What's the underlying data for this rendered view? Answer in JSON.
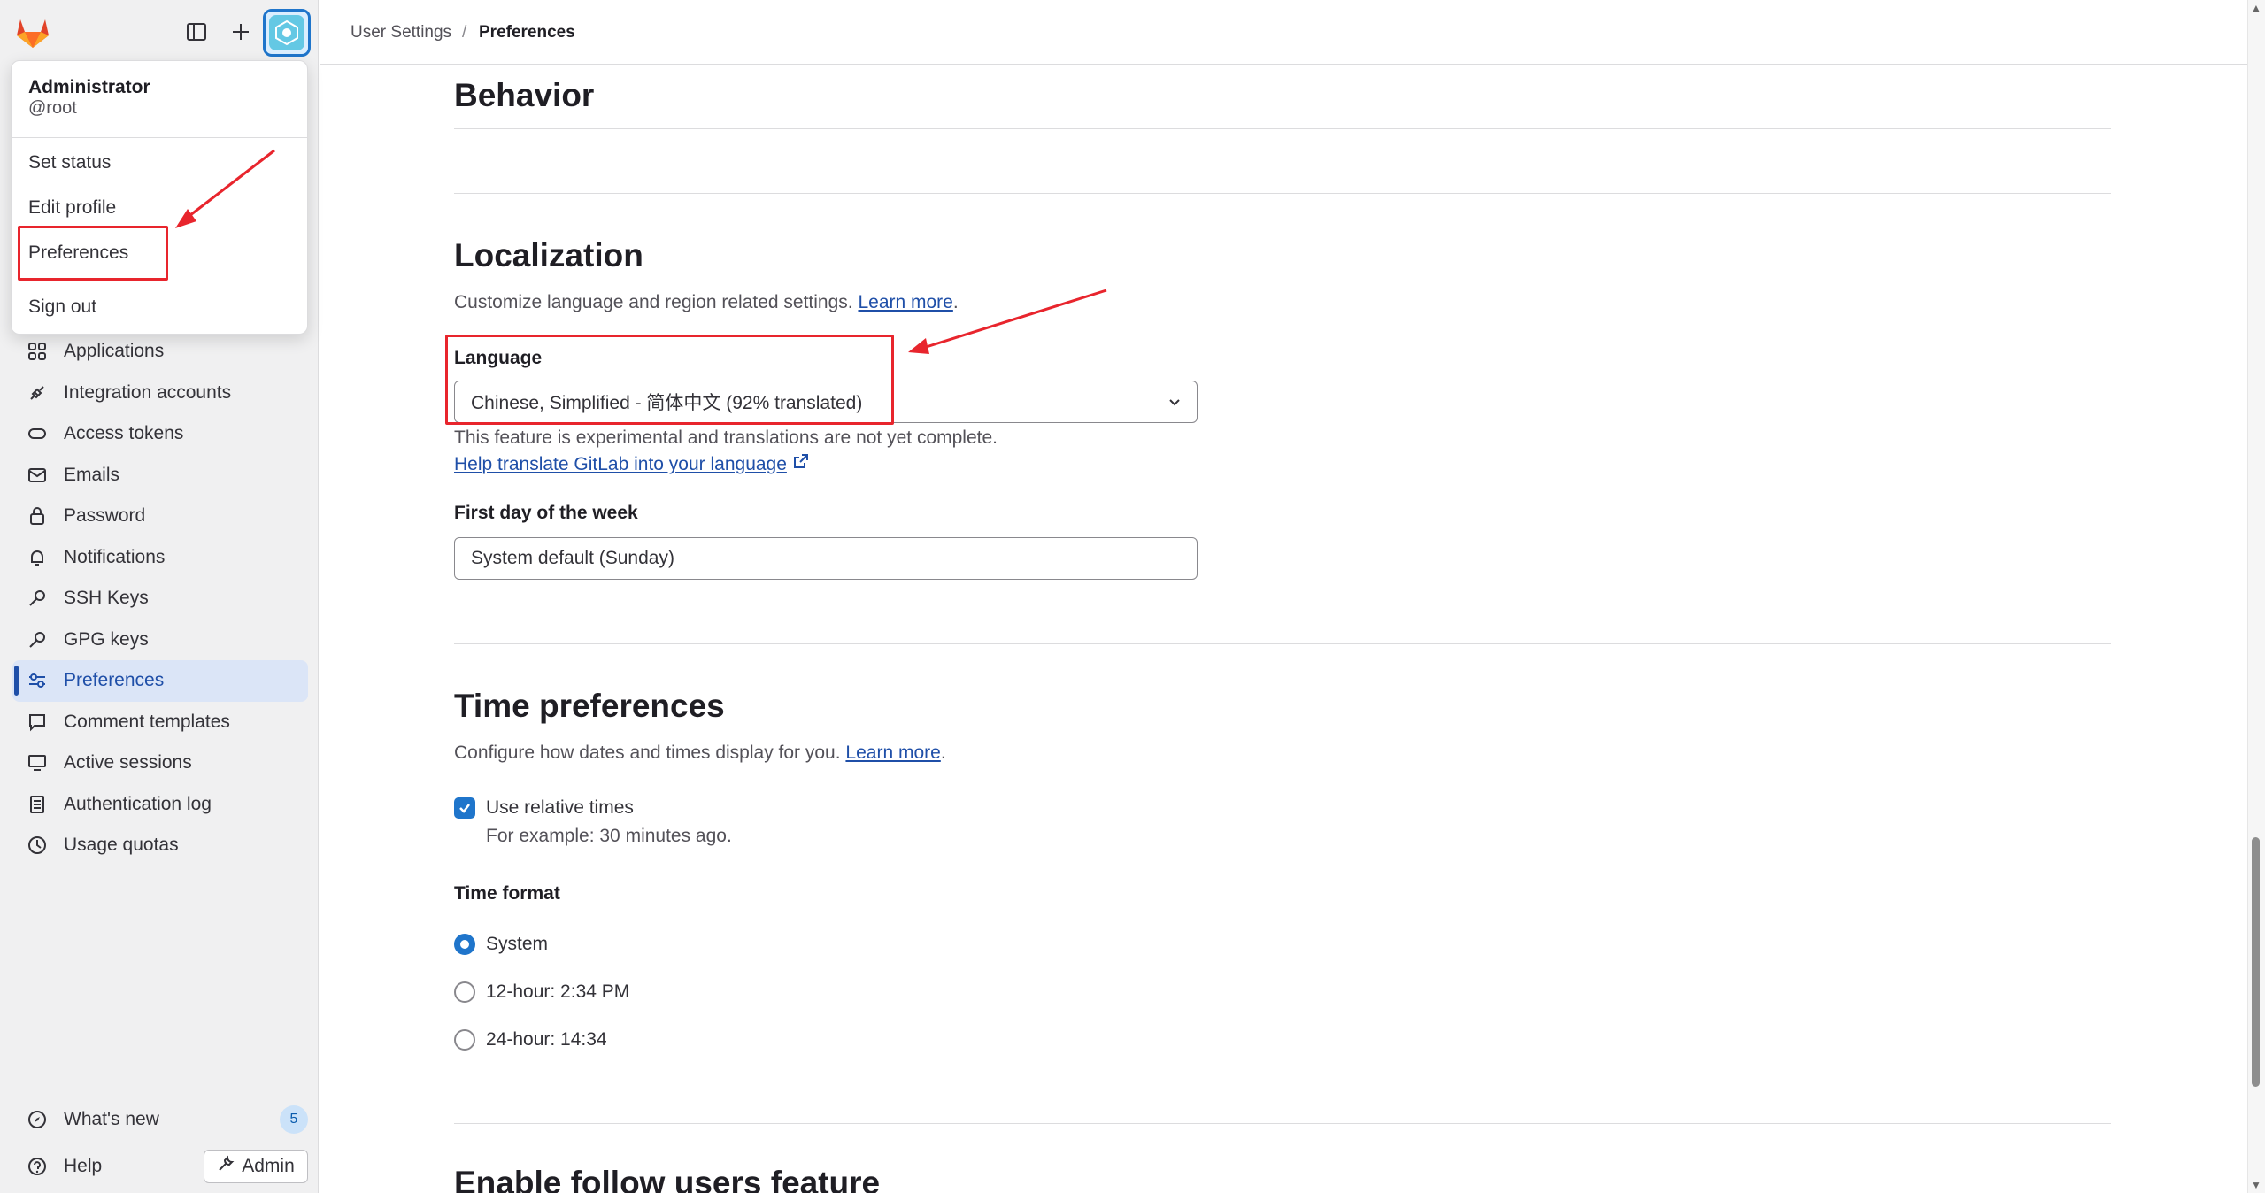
{
  "header": {
    "breadcrumb_parent": "User Settings",
    "breadcrumb_separator": "/",
    "breadcrumb_current": "Preferences"
  },
  "user_menu": {
    "name": "Administrator",
    "username": "@root",
    "items": [
      "Set status",
      "Edit profile",
      "Preferences",
      "Sign out"
    ]
  },
  "sidebar": {
    "items": [
      {
        "label": "Applications",
        "icon": "applications-icon"
      },
      {
        "label": "Integration accounts",
        "icon": "plug-icon"
      },
      {
        "label": "Access tokens",
        "icon": "token-icon"
      },
      {
        "label": "Emails",
        "icon": "mail-icon"
      },
      {
        "label": "Password",
        "icon": "lock-icon"
      },
      {
        "label": "Notifications",
        "icon": "bell-icon"
      },
      {
        "label": "SSH Keys",
        "icon": "key-icon"
      },
      {
        "label": "GPG keys",
        "icon": "key-icon"
      },
      {
        "label": "Preferences",
        "icon": "preferences-icon",
        "active": true
      },
      {
        "label": "Comment templates",
        "icon": "comment-icon"
      },
      {
        "label": "Active sessions",
        "icon": "monitor-icon"
      },
      {
        "label": "Authentication log",
        "icon": "log-icon"
      },
      {
        "label": "Usage quotas",
        "icon": "quota-icon"
      }
    ],
    "whats_new": "What's new",
    "whats_new_count": "5",
    "help": "Help",
    "admin": "Admin"
  },
  "main": {
    "behavior_title": "Behavior",
    "localization": {
      "title": "Localization",
      "description": "Customize language and region related settings.",
      "learn_more": "Learn more",
      "language_label": "Language",
      "language_value": "Chinese, Simplified - 简体中文 (92% translated)",
      "language_note": "This feature is experimental and translations are not yet complete.",
      "translate_link": "Help translate GitLab into your language",
      "first_day_label": "First day of the week",
      "first_day_value": "System default (Sunday)"
    },
    "time": {
      "title": "Time preferences",
      "description": "Configure how dates and times display for you.",
      "learn_more": "Learn more",
      "relative_label": "Use relative times",
      "relative_help": "For example: 30 minutes ago.",
      "format_label": "Time format",
      "options": [
        "System",
        "12-hour: 2:34 PM",
        "24-hour: 14:34"
      ],
      "selected": "System"
    },
    "follow_title": "Enable follow users feature"
  },
  "colors": {
    "accent": "#1f75cb",
    "annotation": "#e8252d",
    "link": "#1f4fa8"
  }
}
